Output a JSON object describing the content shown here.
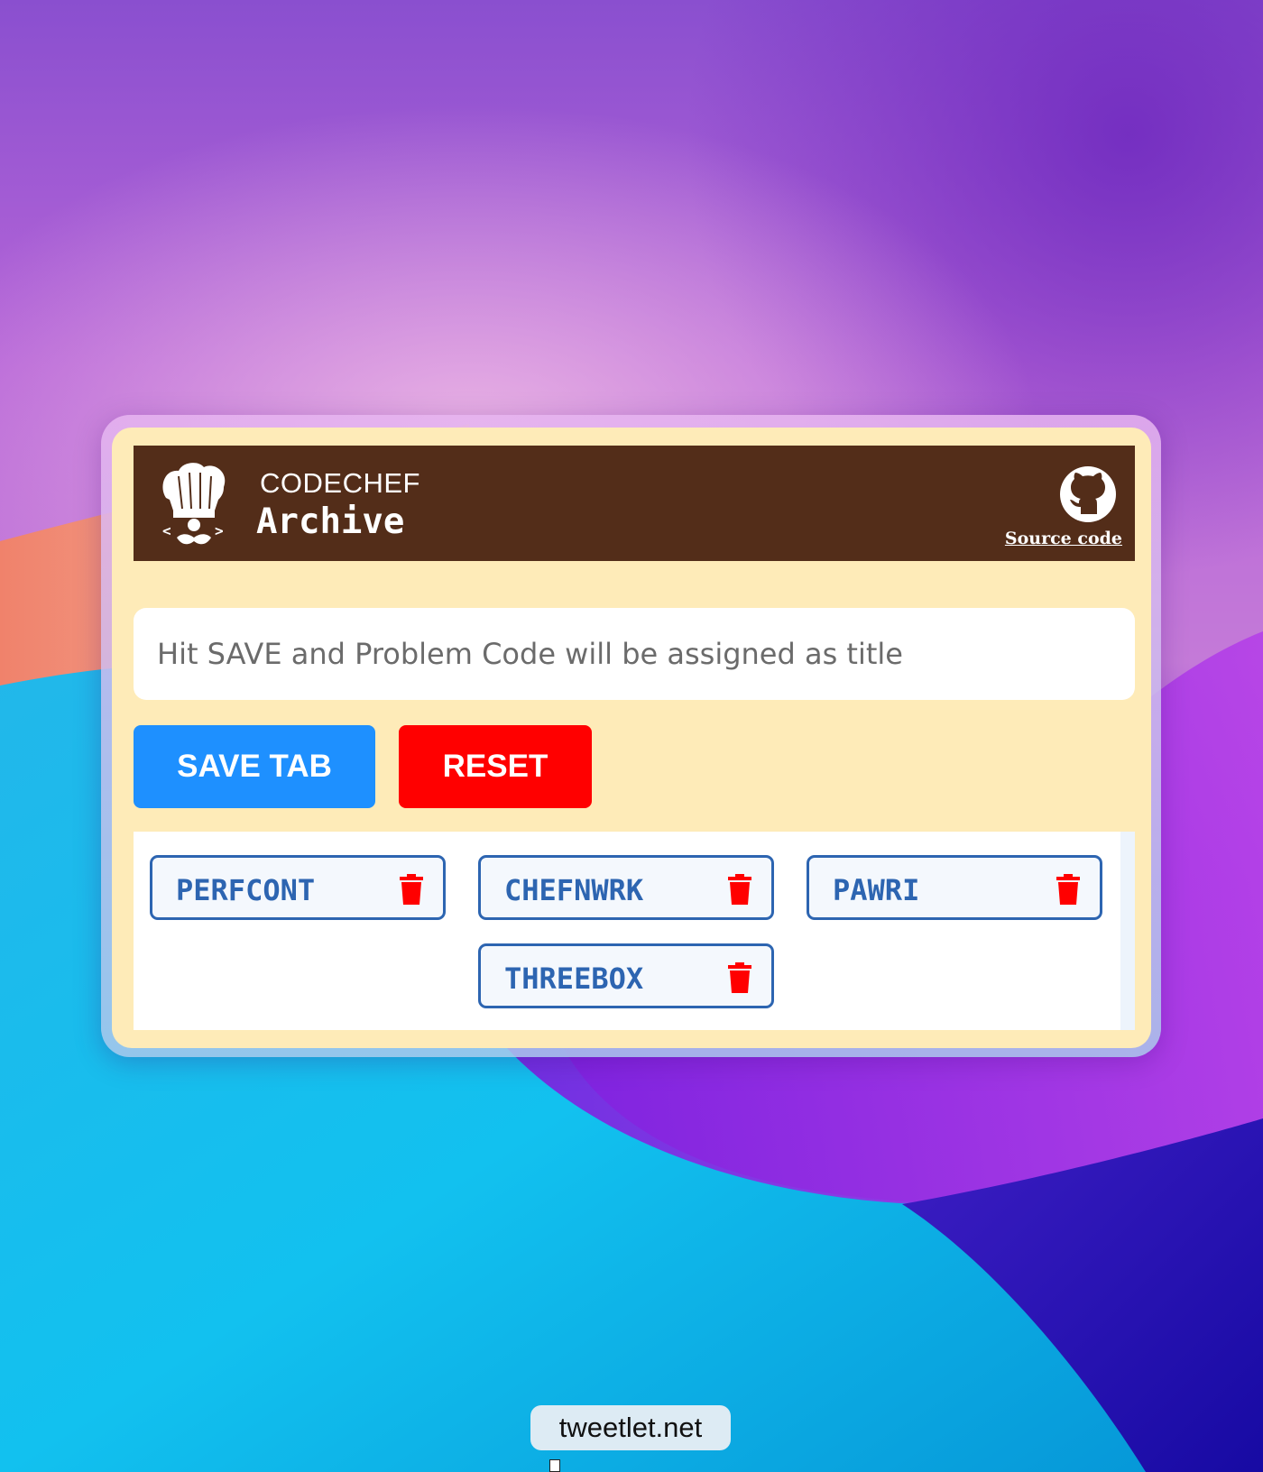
{
  "header": {
    "brand_top": "CODECHEF",
    "brand_bottom": "Archive",
    "logo_icon": "chef-hat-icon",
    "github_icon": "github-icon",
    "source_link": "Source code"
  },
  "input": {
    "placeholder": "Hit SAVE and Problem Code will be assigned as title",
    "value": ""
  },
  "buttons": {
    "save": "SAVE TAB",
    "reset": "RESET"
  },
  "tabs": [
    {
      "label": "PERFCONT",
      "icon": "trash-icon"
    },
    {
      "label": "CHEFNWRK",
      "icon": "trash-icon"
    },
    {
      "label": "PAWRI",
      "icon": "trash-icon"
    },
    {
      "label": "THREEBOX",
      "icon": "trash-icon"
    }
  ],
  "footer": {
    "pill_text": "tweetlet.net"
  },
  "colors": {
    "header_bg": "#532d19",
    "popup_bg": "#feebb8",
    "save_button": "#1e90ff",
    "reset_button": "#ff0000",
    "tab_border": "#2d65b1",
    "trash": "#ff0000"
  }
}
